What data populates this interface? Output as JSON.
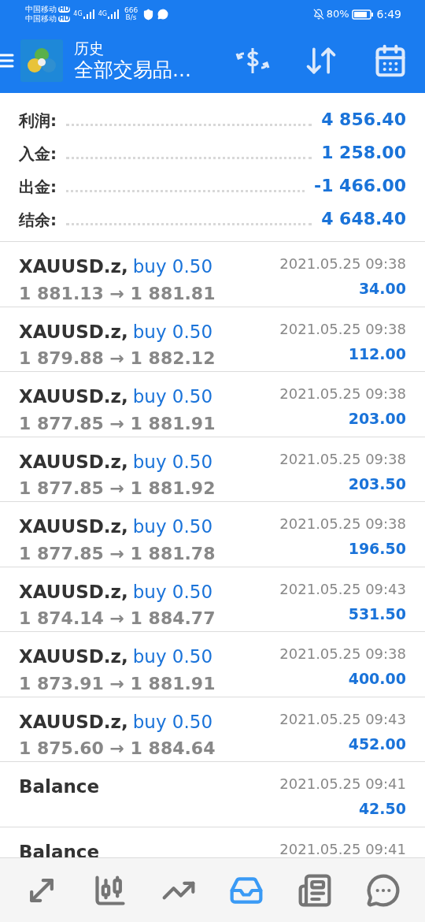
{
  "status_bar": {
    "carriers": [
      {
        "name": "中国移动",
        "badge": "HD"
      },
      {
        "name": "中国移动",
        "badge": "HD"
      }
    ],
    "networks": [
      "4G",
      "4G"
    ],
    "speed": "666",
    "speed_unit": "B/s",
    "battery": "80%",
    "time": "6:49"
  },
  "header": {
    "title": "历史",
    "subtitle": "全部交易品..."
  },
  "summary": [
    {
      "label": "利润:",
      "value": "4 856.40"
    },
    {
      "label": "入金:",
      "value": "1 258.00"
    },
    {
      "label": "出金:",
      "value": "-1 466.00"
    },
    {
      "label": "结余:",
      "value": "4 648.40"
    }
  ],
  "deals": [
    {
      "kind": "trade",
      "symbol": "XAUUSD.z,",
      "side": "buy 0.50",
      "prices": "1 881.13 → 1 881.81",
      "time": "2021.05.25 09:38",
      "profit": "34.00"
    },
    {
      "kind": "trade",
      "symbol": "XAUUSD.z,",
      "side": "buy 0.50",
      "prices": "1 879.88 → 1 882.12",
      "time": "2021.05.25 09:38",
      "profit": "112.00"
    },
    {
      "kind": "trade",
      "symbol": "XAUUSD.z,",
      "side": "buy 0.50",
      "prices": "1 877.85 → 1 881.91",
      "time": "2021.05.25 09:38",
      "profit": "203.00"
    },
    {
      "kind": "trade",
      "symbol": "XAUUSD.z,",
      "side": "buy 0.50",
      "prices": "1 877.85 → 1 881.92",
      "time": "2021.05.25 09:38",
      "profit": "203.50"
    },
    {
      "kind": "trade",
      "symbol": "XAUUSD.z,",
      "side": "buy 0.50",
      "prices": "1 877.85 → 1 881.78",
      "time": "2021.05.25 09:38",
      "profit": "196.50"
    },
    {
      "kind": "trade",
      "symbol": "XAUUSD.z,",
      "side": "buy 0.50",
      "prices": "1 874.14 → 1 884.77",
      "time": "2021.05.25 09:43",
      "profit": "531.50"
    },
    {
      "kind": "trade",
      "symbol": "XAUUSD.z,",
      "side": "buy 0.50",
      "prices": "1 873.91 → 1 881.91",
      "time": "2021.05.25 09:38",
      "profit": "400.00"
    },
    {
      "kind": "trade",
      "symbol": "XAUUSD.z,",
      "side": "buy 0.50",
      "prices": "1 875.60 → 1 884.64",
      "time": "2021.05.25 09:43",
      "profit": "452.00"
    },
    {
      "kind": "balance",
      "symbol": "Balance",
      "time": "2021.05.25 09:41",
      "profit": "42.50"
    },
    {
      "kind": "balance",
      "symbol": "Balance",
      "time": "2021.05.25 09:41"
    }
  ],
  "bottom_nav": [
    {
      "kind": "quotes",
      "selected": false
    },
    {
      "kind": "chart",
      "selected": false
    },
    {
      "kind": "trade",
      "selected": false
    },
    {
      "kind": "history",
      "selected": true
    },
    {
      "kind": "news",
      "selected": false
    },
    {
      "kind": "chat",
      "selected": false
    }
  ]
}
